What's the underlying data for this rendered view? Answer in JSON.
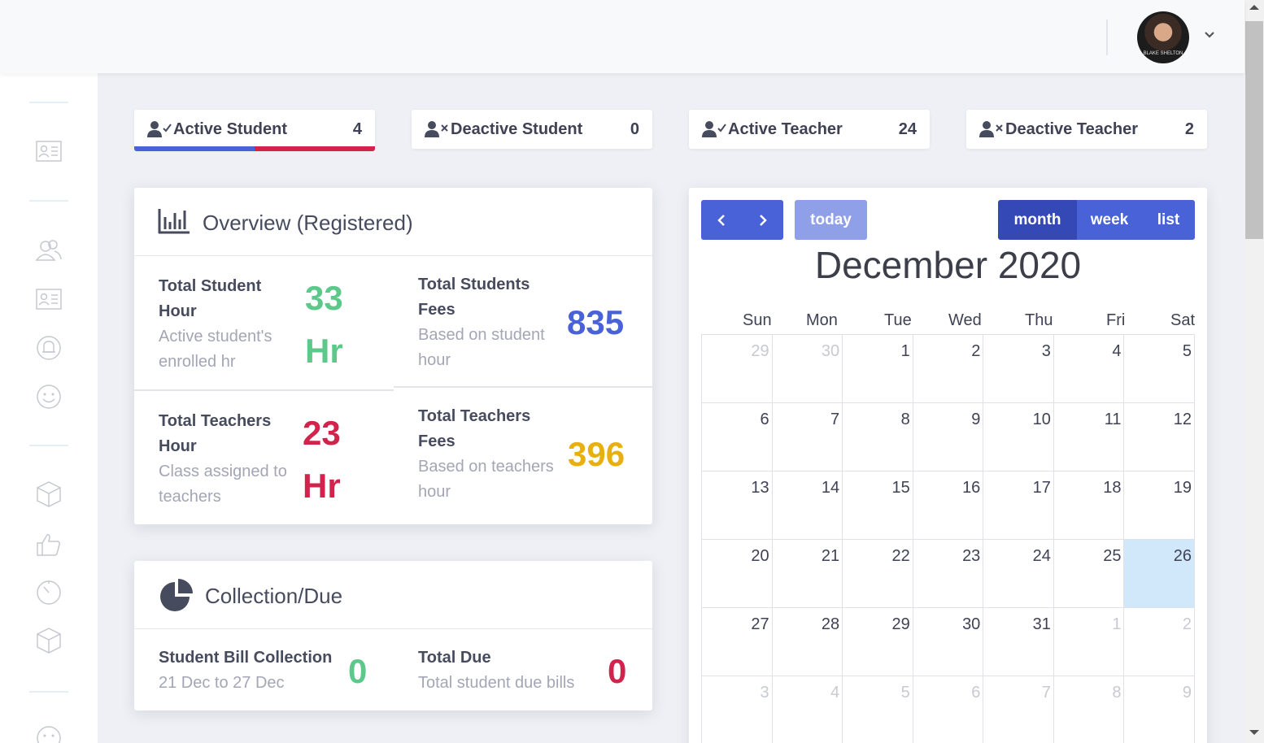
{
  "header": {
    "avatar_signature": "BLAKE SHELTON"
  },
  "colors": {
    "blue": "#4a62d8",
    "green": "#5cc88a",
    "red": "#d1234b",
    "yellow": "#e8b00f",
    "today_bg": "#d1e8fb"
  },
  "stats": [
    {
      "label": "Active Student",
      "count": "4",
      "icon": "user-check-icon"
    },
    {
      "label": "Deactive Student",
      "count": "0",
      "icon": "user-times-icon"
    },
    {
      "label": "Active Teacher",
      "count": "24",
      "icon": "user-check-icon"
    },
    {
      "label": "Deactive Teacher",
      "count": "2",
      "icon": "user-times-icon"
    }
  ],
  "overview": {
    "title": "Overview (Registered)",
    "student_hour": {
      "title_1": "Total Student",
      "title_2": "Hour",
      "sub_1": "Active student's",
      "sub_2": "enrolled hr",
      "value": "33",
      "unit": "Hr"
    },
    "student_fees": {
      "title_1": "Total Students",
      "title_2": "Fees",
      "sub_1": "Based on student",
      "sub_2": "hour",
      "value": "835"
    },
    "teacher_hour": {
      "title_1": "Total Teachers",
      "title_2": "Hour",
      "sub_1": "Class assigned to",
      "sub_2": "teachers",
      "value": "23",
      "unit": "Hr"
    },
    "teacher_fees": {
      "title_1": "Total Teachers",
      "title_2": "Fees",
      "sub_1": "Based on teachers",
      "sub_2": "hour",
      "value": "396"
    }
  },
  "collection": {
    "title": "Collection/Due",
    "bill": {
      "title": "Student Bill Collection",
      "sub": "21 Dec to 27 Dec",
      "value": "0"
    },
    "due": {
      "title": "Total Due",
      "sub": "Total student due bills",
      "value": "0"
    }
  },
  "calendar": {
    "today_label": "today",
    "views": [
      "month",
      "week",
      "list"
    ],
    "title": "December 2020",
    "weekdays": [
      "Sun",
      "Mon",
      "Tue",
      "Wed",
      "Thu",
      "Fri",
      "Sat"
    ],
    "weeks": [
      [
        "29",
        "30",
        "1",
        "2",
        "3",
        "4",
        "5"
      ],
      [
        "6",
        "7",
        "8",
        "9",
        "10",
        "11",
        "12"
      ],
      [
        "13",
        "14",
        "15",
        "16",
        "17",
        "18",
        "19"
      ],
      [
        "20",
        "21",
        "22",
        "23",
        "24",
        "25",
        "26"
      ],
      [
        "27",
        "28",
        "29",
        "30",
        "31",
        "1",
        "2"
      ],
      [
        "3",
        "4",
        "5",
        "6",
        "7",
        "8",
        "9"
      ]
    ],
    "today": "26"
  }
}
